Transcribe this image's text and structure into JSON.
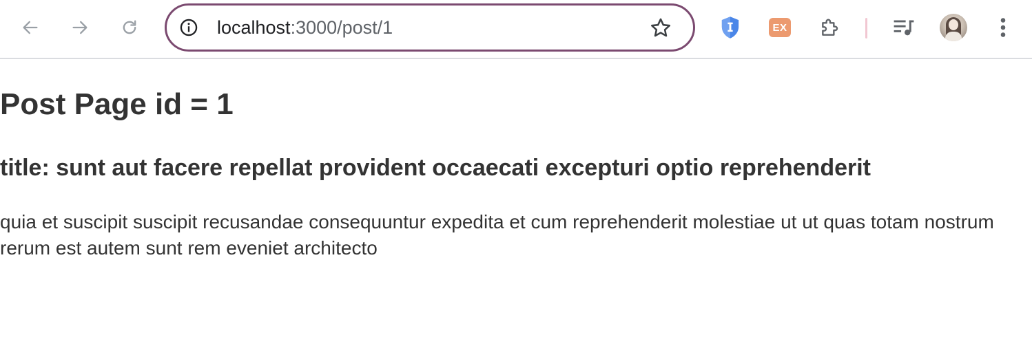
{
  "browser": {
    "url_host": "localhost",
    "url_path": ":3000/post/1",
    "omnibox_border_color": "#7b4a70",
    "extensions": [
      {
        "name": "shield-extension-icon",
        "color": "#4a86e8"
      },
      {
        "name": "ex-extension",
        "label": "EX",
        "color": "#ec9a6f"
      },
      {
        "name": "puzzle-extensions-icon"
      },
      {
        "name": "media-queue-icon"
      }
    ]
  },
  "page": {
    "heading": "Post Page id = 1",
    "title": "title: sunt aut facere repellat provident occaecati excepturi optio reprehenderit",
    "body": "quia et suscipit suscipit recusandae consequuntur expedita et cum reprehenderit molestiae ut ut quas totam nostrum rerum est autem sunt rem eveniet architecto"
  }
}
